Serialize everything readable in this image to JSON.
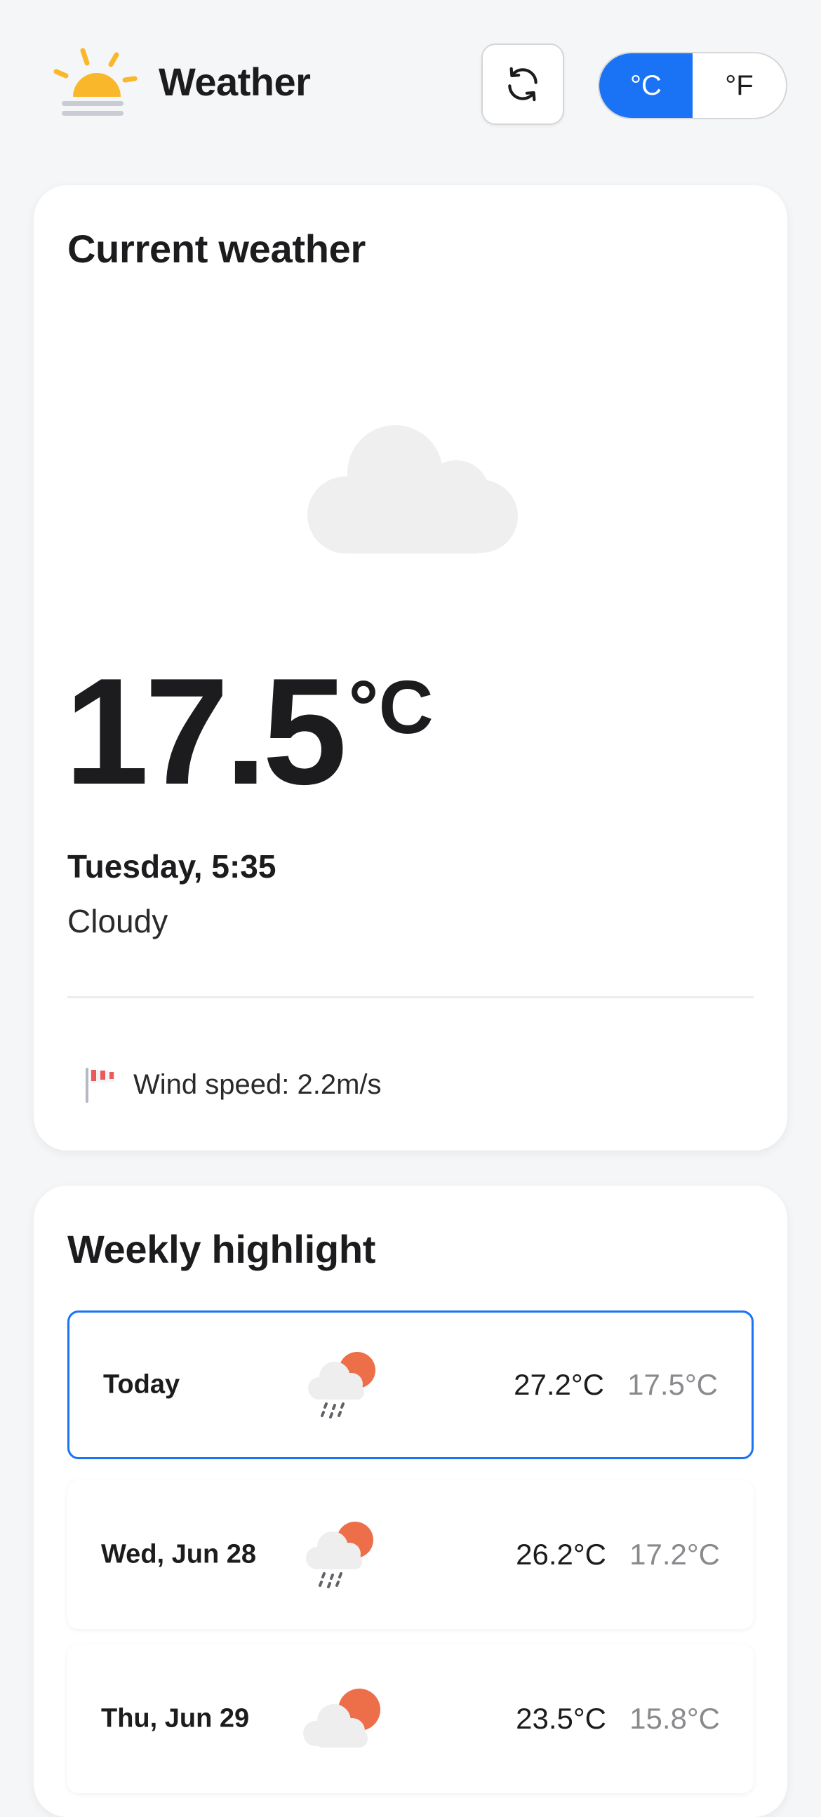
{
  "header": {
    "title": "Weather",
    "logo_icon": "sun-haze-icon",
    "refresh_icon": "refresh-icon",
    "units": [
      {
        "label": "°C",
        "active": true
      },
      {
        "label": "°F",
        "active": false
      }
    ]
  },
  "current": {
    "title": "Current weather",
    "icon": "cloud-icon",
    "temperature": "17.5",
    "unit": "°C",
    "datetime": "Tuesday, 5:35",
    "condition": "Cloudy",
    "wind_icon": "windsock-icon",
    "wind": "Wind speed: 2.2m/s"
  },
  "weekly": {
    "title": "Weekly highlight",
    "days": [
      {
        "label": "Today",
        "icon": "rain-sun-icon",
        "high": "27.2°C",
        "low": "17.5°C",
        "selected": true
      },
      {
        "label": "Wed, Jun 28",
        "icon": "rain-sun-icon",
        "high": "26.2°C",
        "low": "17.2°C",
        "selected": false
      },
      {
        "label": "Thu, Jun 29",
        "icon": "cloud-sun-icon",
        "high": "23.5°C",
        "low": "15.8°C",
        "selected": false
      }
    ]
  },
  "colors": {
    "accent": "#1a73f5",
    "sun": "#f9b82b",
    "sun_orange": "#ec6f4a",
    "cloud": "#eeeeee",
    "muted_text": "#8a8a8e"
  }
}
